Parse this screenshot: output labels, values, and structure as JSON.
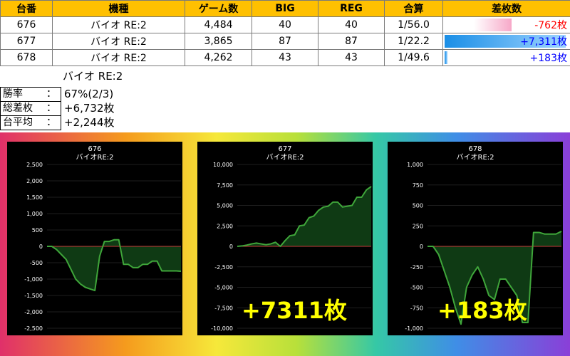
{
  "table": {
    "headers": [
      "台番",
      "機種",
      "ゲーム数",
      "BIG",
      "REG",
      "合算",
      "差枚数"
    ],
    "rows": [
      {
        "number": "676",
        "machine": "バイオ RE:2",
        "games": "4,484",
        "big": "40",
        "reg": "40",
        "combined": "1/56.0",
        "diff": "-762枚",
        "diff_value": -762,
        "diff_color": "#ff0000"
      },
      {
        "number": "677",
        "machine": "バイオ RE:2",
        "games": "3,865",
        "big": "87",
        "reg": "87",
        "combined": "1/22.2",
        "diff": "+7,311枚",
        "diff_value": 7311,
        "diff_color": "#0000ff"
      },
      {
        "number": "678",
        "machine": "バイオ RE:2",
        "games": "4,262",
        "big": "43",
        "reg": "43",
        "combined": "1/49.6",
        "diff": "+183枚",
        "diff_value": 183,
        "diff_color": "#0000ff"
      }
    ],
    "diff_max": 7311
  },
  "summary": {
    "title": "バイオ RE:2",
    "win_rate_label": "勝率",
    "win_rate": "67%(2/3)",
    "total_diff_label": "総差枚",
    "total_diff": "+6,732枚",
    "avg_label": "台平均",
    "avg": "+2,244枚",
    "colon": "："
  },
  "chart_data": [
    {
      "type": "line",
      "title": "676",
      "subtitle": "バイオRE:2",
      "ylim": [
        -2500,
        2500
      ],
      "yticks": [
        "2,500",
        "2,000",
        "1,500",
        "1,000",
        "500",
        "0",
        "-500",
        "-1,000",
        "-1,500",
        "-2,000",
        "-2,500"
      ],
      "values": [
        0,
        0,
        -100,
        -250,
        -400,
        -700,
        -1000,
        -1150,
        -1250,
        -1300,
        -1350,
        -300,
        150,
        150,
        200,
        200,
        -550,
        -550,
        -650,
        -650,
        -550,
        -550,
        -450,
        -450,
        -750,
        -750,
        -750,
        -750,
        -762
      ],
      "overlay": ""
    },
    {
      "type": "line",
      "title": "677",
      "subtitle": "バイオRE:2",
      "ylim": [
        -10000,
        10000
      ],
      "yticks": [
        "10,000",
        "7,500",
        "5,000",
        "2,500",
        "0",
        "-2,500",
        "-5,000",
        "-7,500",
        "-10,000"
      ],
      "values": [
        0,
        50,
        150,
        300,
        400,
        300,
        200,
        300,
        500,
        0,
        700,
        1300,
        1400,
        2500,
        2600,
        3500,
        3700,
        4400,
        4800,
        4900,
        5400,
        5400,
        4800,
        4900,
        5000,
        6000,
        6000,
        6900,
        7311
      ],
      "overlay": "+7311枚"
    },
    {
      "type": "line",
      "title": "678",
      "subtitle": "バイオRE:2",
      "ylim": [
        -1000,
        1000
      ],
      "yticks": [
        "1,000",
        "750",
        "500",
        "250",
        "0",
        "-250",
        "-500",
        "-750",
        "-1,000"
      ],
      "values": [
        0,
        0,
        -100,
        -300,
        -500,
        -750,
        -950,
        -500,
        -350,
        -250,
        -400,
        -600,
        -650,
        -400,
        -400,
        -500,
        -600,
        -930,
        -930,
        170,
        170,
        150,
        150,
        150,
        183
      ],
      "overlay": "+183枚"
    }
  ],
  "colors": {
    "header_bg": "#ffc000",
    "negative": "#ff0000",
    "positive": "#0000ff",
    "line": "#3fa63a",
    "fill": "#0f3a14",
    "zero_line": "#c83a3a",
    "panel_bg": "#000000",
    "overlay_text": "#ffff00"
  }
}
